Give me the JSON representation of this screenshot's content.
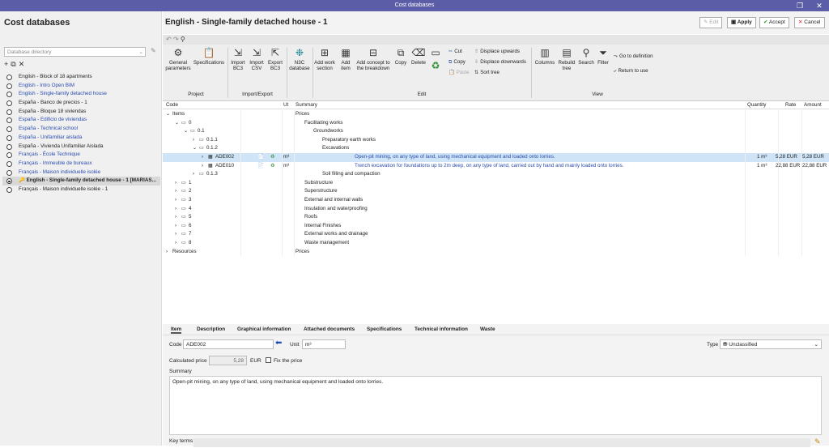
{
  "window": {
    "title": "Cost databases",
    "restore_glyph": "❐",
    "close_glyph": "✕"
  },
  "left": {
    "title": "Cost databases",
    "directory_placeholder": "Database directory",
    "databases": [
      {
        "label": "English - Block of 18 apartments",
        "style": "plain"
      },
      {
        "label": "English - Intro Open BIM",
        "style": "blue"
      },
      {
        "label": "English - Single-family detached house",
        "style": "blue"
      },
      {
        "label": "España - Banco de precios - 1",
        "style": "plain"
      },
      {
        "label": "España - Bloque 18 viviendas",
        "style": "plain"
      },
      {
        "label": "España - Edificio de viviendas",
        "style": "blue"
      },
      {
        "label": "España - Technical school",
        "style": "blue"
      },
      {
        "label": "España - Unifamiliar aislada",
        "style": "blue"
      },
      {
        "label": "España - Vivienda Unifamiliar Aislada",
        "style": "plain"
      },
      {
        "label": "Français - École Technique",
        "style": "blue"
      },
      {
        "label": "Français - Immeuble de bureaux",
        "style": "blue"
      },
      {
        "label": "Français - Maison individuelle isolée",
        "style": "blue"
      },
      {
        "label": "English - Single-family detached house - 1 [MARIAS...",
        "style": "selected"
      },
      {
        "label": "Français - Maison individuelle isolée - 1",
        "style": "plain"
      }
    ]
  },
  "header": {
    "title": "English - Single-family detached house - 1",
    "edit": "Edit",
    "apply": "Apply",
    "accept": "Accept",
    "cancel": "Cancel"
  },
  "ribbon": {
    "general_parameters_1": "General",
    "general_parameters_2": "parameters",
    "specifications": "Specifications",
    "import_bc3_1": "Import",
    "import_bc3_2": "BC3",
    "import_csv_1": "Import",
    "import_csv_2": "CSV",
    "export_bc3_1": "Export",
    "export_bc3_2": "BC3",
    "n3c_1": "N3C",
    "n3c_2": "database",
    "add_work_section_1": "Add work",
    "add_work_section_2": "section",
    "add_item_1": "Add",
    "add_item_2": "item",
    "add_concept_1": "Add concept to",
    "add_concept_2": "the breakdown",
    "copy": "Copy",
    "delete": "Delete",
    "cut": "Cut",
    "copy_small": "Copy",
    "paste": "Paste",
    "displace_up": "Displace upwards",
    "displace_down": "Displace downwards",
    "sort_tree": "Sort tree",
    "columns": "Columns",
    "rebuild_tree_1": "Rebuild",
    "rebuild_tree_2": "tree",
    "search": "Search",
    "filter": "Filter",
    "go_to_definition": "Go to definition",
    "return_to_use": "Return to use",
    "group_project": "Project",
    "group_import_export": "Import/Export",
    "group_edit": "Edit",
    "group_view": "View"
  },
  "grid": {
    "columns": {
      "code": "Code",
      "ut": "Ut",
      "summary": "Summary",
      "quantity": "Quantity",
      "rate": "Rate",
      "amount": "Amount"
    },
    "rows": [
      {
        "expander": "⌄",
        "code": "Items",
        "ut": "",
        "summary": "Prices",
        "quantity": "",
        "rate": "",
        "amount": "",
        "style": ""
      },
      {
        "expander": "⌄",
        "code": "0",
        "ut": "",
        "summary": "Facilitating works",
        "quantity": "",
        "rate": "",
        "amount": "",
        "style": ""
      },
      {
        "expander": "⌄",
        "code": "0.1",
        "ut": "",
        "summary": "Groundworks",
        "quantity": "",
        "rate": "",
        "amount": "",
        "style": ""
      },
      {
        "expander": "›",
        "code": "0.1.1",
        "ut": "",
        "summary": "Preparatory earth works",
        "quantity": "",
        "rate": "",
        "amount": "",
        "style": ""
      },
      {
        "expander": "⌄",
        "code": "0.1.2",
        "ut": "",
        "summary": "Excavations",
        "quantity": "",
        "rate": "",
        "amount": "",
        "style": ""
      },
      {
        "expander": "›",
        "code": "ADE002",
        "ut": "m³",
        "summary": "Open-pit mining, on any type of land, using mechanical equipment and loaded onto lorries.",
        "quantity": "1 m³",
        "rate": "5,28 EUR",
        "amount": "5,28 EUR",
        "style": "sel"
      },
      {
        "expander": "›",
        "code": "ADE010",
        "ut": "m³",
        "summary": "Trench excavation for foundations up to 2m deep, on any type of land, carried out by hand and mainly loaded onto lorries.",
        "quantity": "1 m³",
        "rate": "22,88 EUR",
        "amount": "22,88 EUR",
        "style": "item"
      },
      {
        "expander": "›",
        "code": "0.1.3",
        "ut": "",
        "summary": "Soil filling and compaction",
        "quantity": "",
        "rate": "",
        "amount": "",
        "style": ""
      },
      {
        "expander": "›",
        "code": "1",
        "ut": "",
        "summary": "Substructure",
        "quantity": "",
        "rate": "",
        "amount": "",
        "style": ""
      },
      {
        "expander": "›",
        "code": "2",
        "ut": "",
        "summary": "Superstructure",
        "quantity": "",
        "rate": "",
        "amount": "",
        "style": ""
      },
      {
        "expander": "›",
        "code": "3",
        "ut": "",
        "summary": "External and internal walls",
        "quantity": "",
        "rate": "",
        "amount": "",
        "style": ""
      },
      {
        "expander": "›",
        "code": "4",
        "ut": "",
        "summary": "Insulation and waterproofing",
        "quantity": "",
        "rate": "",
        "amount": "",
        "style": ""
      },
      {
        "expander": "›",
        "code": "5",
        "ut": "",
        "summary": "Roofs",
        "quantity": "",
        "rate": "",
        "amount": "",
        "style": ""
      },
      {
        "expander": "›",
        "code": "6",
        "ut": "",
        "summary": "Internal Finishes",
        "quantity": "",
        "rate": "",
        "amount": "",
        "style": ""
      },
      {
        "expander": "›",
        "code": "7",
        "ut": "",
        "summary": "External works and drainage",
        "quantity": "",
        "rate": "",
        "amount": "",
        "style": ""
      },
      {
        "expander": "›",
        "code": "8",
        "ut": "",
        "summary": "Waste management",
        "quantity": "",
        "rate": "",
        "amount": "",
        "style": ""
      },
      {
        "expander": "›",
        "code": "Resources",
        "ut": "",
        "summary": "Prices",
        "quantity": "",
        "rate": "",
        "amount": "",
        "style": ""
      }
    ]
  },
  "detail": {
    "tabs": [
      "Item",
      "Description",
      "Graphical information",
      "Attached documents",
      "Specifications",
      "Technical information",
      "Waste"
    ],
    "code_label": "Code",
    "code_value": "ADE002",
    "unit_label": "Unit",
    "unit_value": "m³",
    "type_label": "Type",
    "type_value": "Unclassified",
    "calc_price_label": "Calculated price",
    "calc_price_value": "5,28",
    "currency": "EUR",
    "fix_price": "Fix the price",
    "summary_label": "Summary",
    "summary_text": "Open-pit mining, on any type of land, using mechanical equipment and loaded onto lorries.",
    "key_terms_label": "Key terms"
  }
}
